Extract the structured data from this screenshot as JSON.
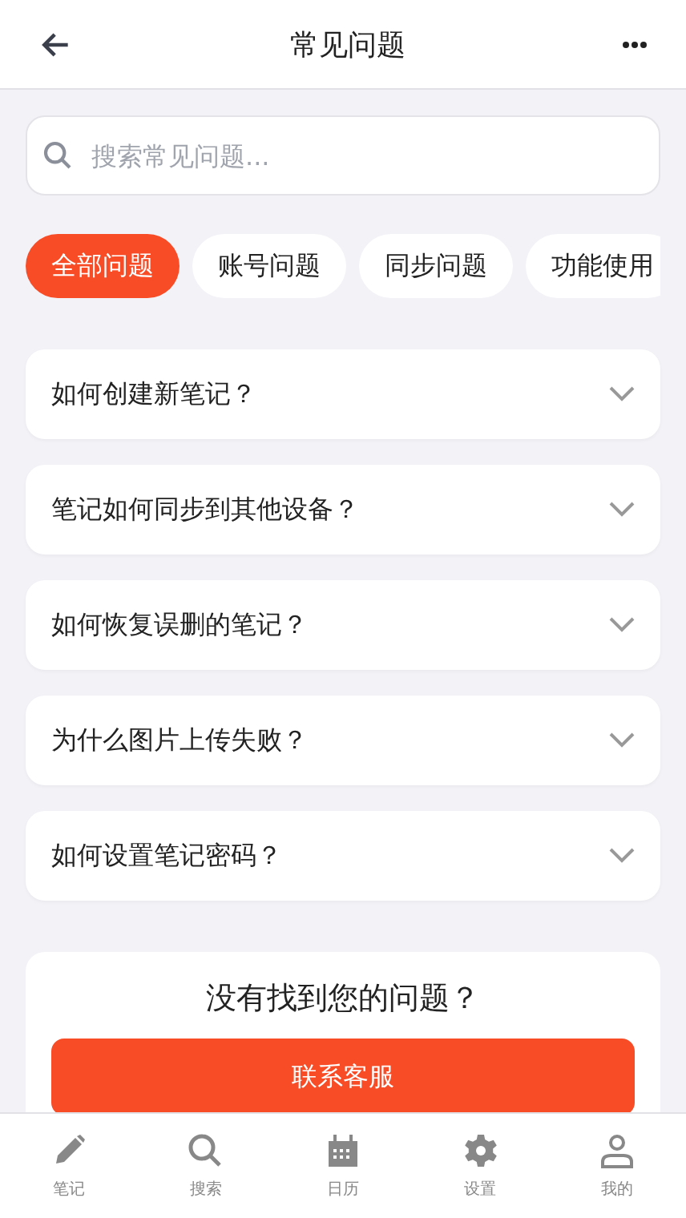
{
  "header": {
    "title": "常见问题"
  },
  "search": {
    "placeholder": "搜索常见问题..."
  },
  "categories": [
    {
      "label": "全部问题",
      "selected": true
    },
    {
      "label": "账号问题",
      "selected": false
    },
    {
      "label": "同步问题",
      "selected": false
    },
    {
      "label": "功能使用",
      "selected": false
    }
  ],
  "faqs": [
    {
      "question": "如何创建新笔记？",
      "expanded": false
    },
    {
      "question": "笔记如何同步到其他设备？",
      "expanded": false
    },
    {
      "question": "如何恢复误删的笔记？",
      "expanded": false
    },
    {
      "question": "为什么图片上传失败？",
      "expanded": false
    },
    {
      "question": "如何设置笔记密码？",
      "expanded": false
    }
  ],
  "support": {
    "title": "没有找到您的问题？",
    "button": "联系客服"
  },
  "tab_bar": [
    {
      "kind": "pencil",
      "label": "笔记"
    },
    {
      "kind": "search",
      "label": "搜索"
    },
    {
      "kind": "calendar",
      "label": "日历"
    },
    {
      "kind": "gear",
      "label": "设置"
    },
    {
      "kind": "person",
      "label": "我的"
    }
  ]
}
